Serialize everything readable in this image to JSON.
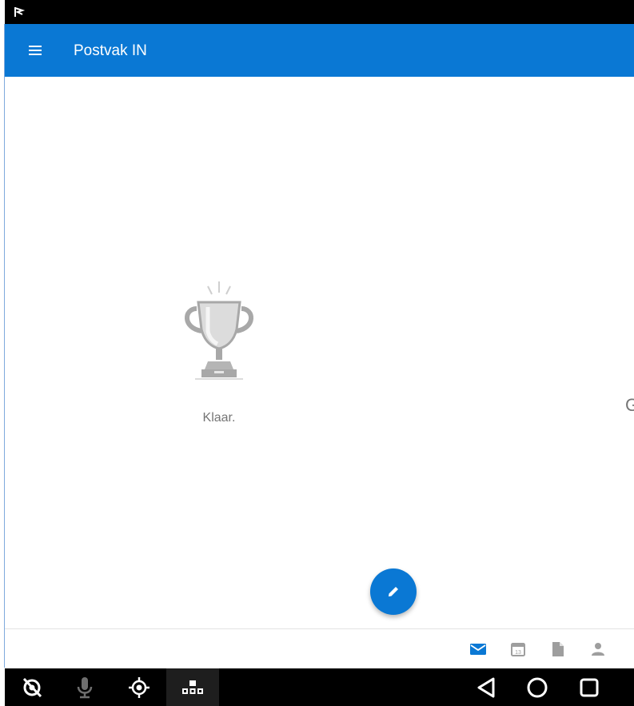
{
  "app": {
    "title": "Postvak IN"
  },
  "empty_state": {
    "label": "Klaar.",
    "icon": "trophy-icon"
  },
  "cutoff_text": "G",
  "colors": {
    "accent": "#0a78d4",
    "status_bar": "#000000",
    "muted_text": "#757575",
    "inactive_icon": "#9e9e9e"
  },
  "bottom_tabs": [
    {
      "icon": "mail-icon",
      "active": true
    },
    {
      "icon": "calendar-icon",
      "label": "13",
      "active": false
    },
    {
      "icon": "file-icon",
      "active": false
    },
    {
      "icon": "person-icon",
      "active": false
    }
  ],
  "nav_bar": {
    "left_icons": [
      "eye-off-icon",
      "microphone-icon",
      "crosshair-icon",
      "grid-icon"
    ],
    "right_icons": [
      "back-icon",
      "home-icon",
      "recents-icon"
    ]
  }
}
